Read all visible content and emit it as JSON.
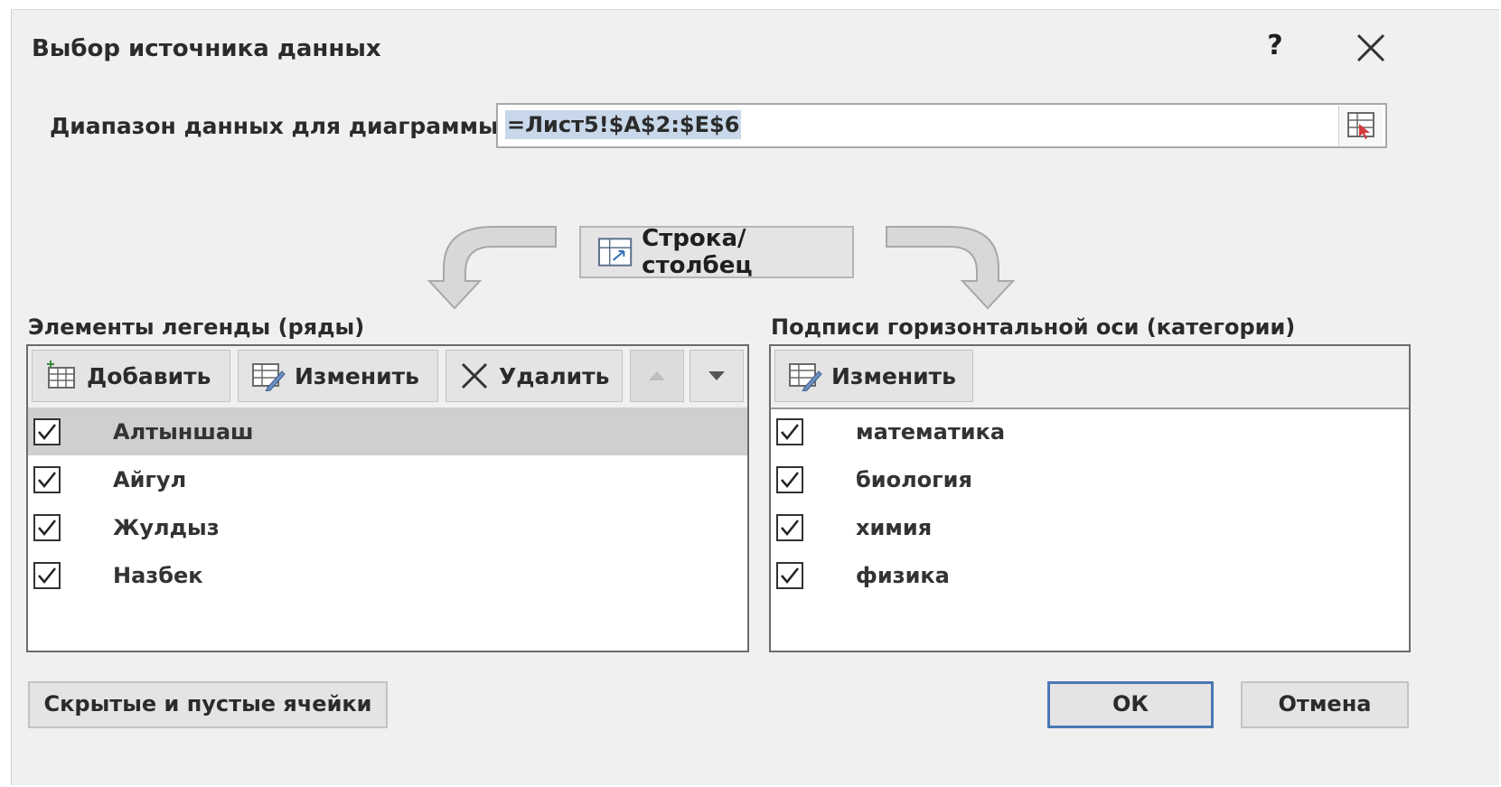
{
  "dialog": {
    "title": "Выбор источника данных",
    "help_label": "?",
    "close_icon": "close-icon"
  },
  "range": {
    "label": "Диапазон данных для диаграммы:",
    "value": "=Лист5!$A$2:$E$6",
    "picker_icon": "range-selector-icon"
  },
  "switch_button": {
    "label": "Строка/столбец",
    "icon": "switch-row-column-icon"
  },
  "legend": {
    "label": "Элементы легенды (ряды)",
    "buttons": {
      "add": "Добавить",
      "edit": "Изменить",
      "delete": "Удалить"
    },
    "move_up_icon": "triangle-up-icon",
    "move_down_icon": "triangle-down-icon",
    "items": [
      {
        "label": "Алтыншаш",
        "checked": true,
        "selected": true
      },
      {
        "label": "Айгул",
        "checked": true,
        "selected": false
      },
      {
        "label": "Жулдыз",
        "checked": true,
        "selected": false
      },
      {
        "label": "Назбек",
        "checked": true,
        "selected": false
      }
    ]
  },
  "axis": {
    "label": "Подписи горизонтальной оси (категории)",
    "buttons": {
      "edit": "Изменить"
    },
    "items": [
      {
        "label": "математика",
        "checked": true
      },
      {
        "label": "биология",
        "checked": true
      },
      {
        "label": "химия",
        "checked": true
      },
      {
        "label": "физика",
        "checked": true
      }
    ]
  },
  "footer": {
    "hidden_cells": "Скрытые и пустые ячейки",
    "ok": "ОК",
    "cancel": "Отмена"
  },
  "colors": {
    "primary_border": "#4a78b5",
    "selection": "#cfcfcf",
    "input_selection": "#c8d8ea"
  }
}
